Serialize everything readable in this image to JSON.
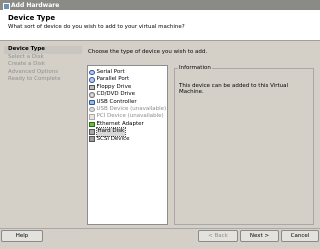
{
  "window": {
    "title": "Add Hardware"
  },
  "header": {
    "title": "Device Type",
    "subtitle": "What sort of device do you wish to add to your virtual machine?"
  },
  "steps": [
    {
      "label": "Device Type",
      "current": true
    },
    {
      "label": "Select a Disk",
      "current": false
    },
    {
      "label": "Create a Disk",
      "current": false
    },
    {
      "label": "Advanced Options",
      "current": false
    },
    {
      "label": "Ready to Complete",
      "current": false
    }
  ],
  "main": {
    "instruction": "Choose the type of device you wish to add.",
    "devices": [
      {
        "label": "Serial Port",
        "icon": "serial-port-icon",
        "style": "round",
        "disabled": false,
        "selected": false
      },
      {
        "label": "Parallel Port",
        "icon": "parallel-port-icon",
        "style": "round",
        "disabled": false,
        "selected": false
      },
      {
        "label": "Floppy Drive",
        "icon": "floppy-drive-icon",
        "style": "disk",
        "disabled": false,
        "selected": false
      },
      {
        "label": "CD/DVD Drive",
        "icon": "cd-dvd-drive-icon",
        "style": "cd",
        "disabled": false,
        "selected": false
      },
      {
        "label": "USB Controller",
        "icon": "usb-controller-icon",
        "style": "usb",
        "disabled": false,
        "selected": false
      },
      {
        "label": "USB Device (unavailable)",
        "icon": "usb-device-icon",
        "style": "round gray",
        "disabled": true,
        "selected": false
      },
      {
        "label": "PCI Device (unavailable)",
        "icon": "pci-device-icon",
        "style": "pci",
        "disabled": true,
        "selected": false
      },
      {
        "label": "Ethernet Adapter",
        "icon": "ethernet-adapter-icon",
        "style": "eth",
        "disabled": false,
        "selected": false
      },
      {
        "label": "Hard Disk",
        "icon": "hard-disk-icon",
        "style": "hdd",
        "disabled": false,
        "selected": true
      },
      {
        "label": "SCSI Device",
        "icon": "scsi-device-icon",
        "style": "scsi",
        "disabled": false,
        "selected": false
      }
    ],
    "information": {
      "legend": "Information",
      "message": "This device can be added to this Virtual Machine."
    }
  },
  "buttons": {
    "help": "Help",
    "back": "< Back",
    "next": "Next >",
    "cancel": "Cancel"
  }
}
